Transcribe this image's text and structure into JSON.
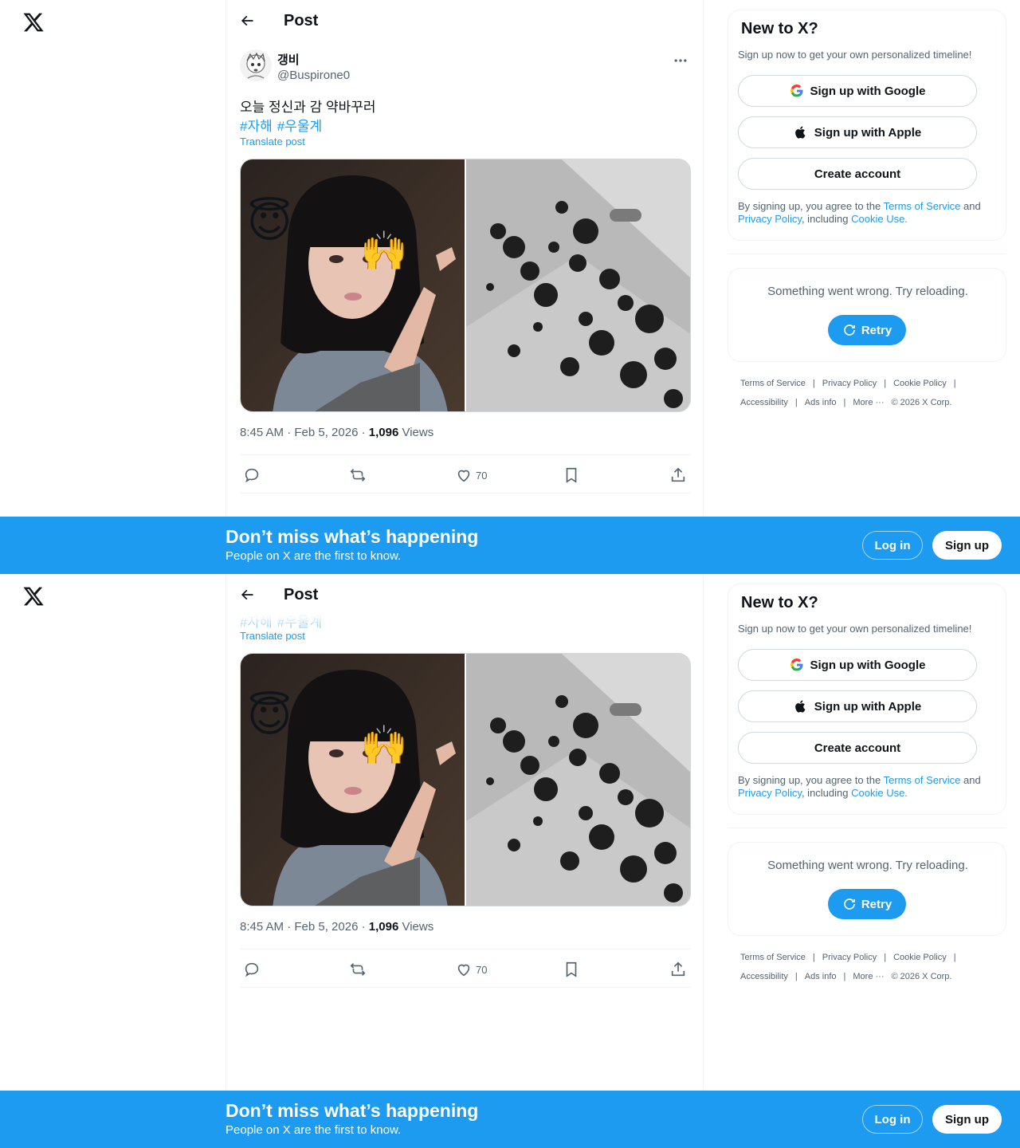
{
  "colors": {
    "accent": "#1d9bf0",
    "text": "#0f1419",
    "muted": "#536471",
    "border": "#eff3f4"
  },
  "header": {
    "title": "Post",
    "back_icon": "arrow-left-icon",
    "logo_icon": "x-logo-icon"
  },
  "post": {
    "display_name": "갱비",
    "handle": "@Buspirone0",
    "text": "오늘 정신과 감 약바꾸러",
    "hashtags": [
      "#자해",
      "#우울계"
    ],
    "translate_label": "Translate post",
    "time": "8:45 AM · Feb 5, 2026 · ",
    "views_count": "1,096",
    "views_label": " Views",
    "likes": "70",
    "emojis": [
      "😇",
      "🙌"
    ]
  },
  "sidebar": {
    "signup_card": {
      "title": "New to X?",
      "subtitle": "Sign up now to get your own personalized timeline!",
      "google_label": "Sign up with Google",
      "apple_label": "Sign up with Apple",
      "create_label": "Create account",
      "terms_prefix": "By signing up, you agree to the ",
      "terms_link": "Terms of Service",
      "terms_and": " and ",
      "privacy_link": "Privacy Policy",
      "terms_including": ", including ",
      "cookie_link": "Cookie Use."
    },
    "error_card": {
      "message": "Something went wrong. Try reloading.",
      "retry_label": "Retry"
    },
    "footer": {
      "terms": "Terms of Service",
      "privacy": "Privacy Policy",
      "cookie": "Cookie Policy",
      "accessibility": "Accessibility",
      "ads": "Ads info",
      "more": "More ···",
      "copyright": "© 2026 X Corp.",
      "sep": "|"
    }
  },
  "banner": {
    "title": "Don’t miss what’s happening",
    "subtitle": "People on X are the first to know.",
    "login_label": "Log in",
    "signup_label": "Sign up"
  }
}
